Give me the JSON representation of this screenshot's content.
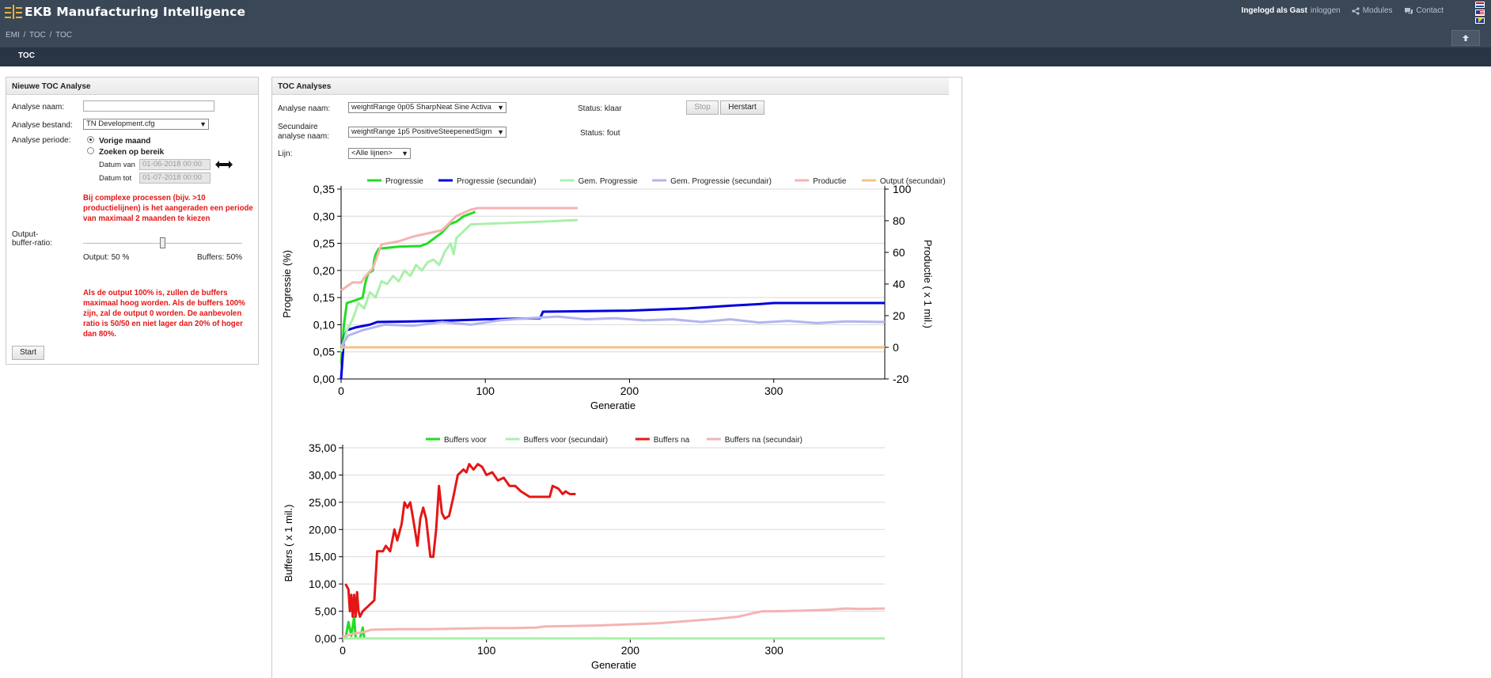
{
  "app": {
    "title": "EKB Manufacturing Intelligence",
    "breadcrumb": [
      "EMI",
      "TOC",
      "TOC"
    ],
    "breadcrumb_sep": "/",
    "user_label": "Ingelogd als Gast",
    "login_link": "inloggen",
    "modules_link": "Modules",
    "contact_link": "Contact",
    "active_tab": "TOC",
    "flags": [
      "dutch-flag",
      "us-flag",
      "bosnian-flag"
    ]
  },
  "left_panel": {
    "title": "Nieuwe TOC Analyse",
    "name_label": "Analyse naam:",
    "name_value": "",
    "file_label": "Analyse bestand:",
    "file_value": "TN Development.cfg",
    "period_label": "Analyse periode:",
    "radio_prev": "Vorige maand",
    "radio_range": "Zoeken op bereik",
    "date_from_label": "Datum van",
    "date_from_value": "01-06-2018 00:00",
    "date_to_label": "Datum tot",
    "date_to_value": "01-07-2018 00:00",
    "warning_1": "Bij complexe processen (bijv. >10 productielijnen) is het aangeraden een periode van maximaal 2 maanden te kiezen",
    "ratio_label": "Output-buffer-ratio:",
    "output_label": "Output: 50   %",
    "buffers_label": "Buffers: 50%",
    "ratio_value": 0.5,
    "warning_2": "Als de output 100% is, zullen de buffers maximaal hoog worden. Als de buffers 100% zijn, zal de output 0 worden. De aanbevolen ratio is 50/50 en niet lager dan 20% of hoger dan 80%.",
    "start_button": "Start"
  },
  "right_panel": {
    "title": "TOC Analyses",
    "name_label": "Analyse naam:",
    "name_value": "weightRange 0p05 SharpNeat Sine Activa",
    "status_1": "Status: klaar",
    "stop_button": "Stop",
    "restart_button": "Herstart",
    "secondary_label_1": "Secundaire",
    "secondary_label_2": "analyse naam:",
    "secondary_value": "weightRange 1p5 PositiveSteepenedSigm",
    "status_2": "Status: fout",
    "line_label": "Lijn:",
    "line_value": "<Alle lijnen>"
  },
  "chart_data": [
    {
      "type": "line",
      "title": "",
      "xlabel": "Generatie",
      "ylabel": "Progressie (%)",
      "y2label": "Productie  ( x 1 mil.)",
      "xlim": [
        0,
        377
      ],
      "ylim": [
        0,
        0.35
      ],
      "y2lim": [
        -20,
        100
      ],
      "x_ticks": [
        "0",
        "100",
        "200",
        "300"
      ],
      "y_ticks": [
        "0,00",
        "0,05",
        "0,10",
        "0,15",
        "0,20",
        "0,25",
        "0,30",
        "0,35"
      ],
      "y2_ticks": [
        "-20",
        "0",
        "20",
        "40",
        "60",
        "80",
        "100"
      ],
      "grid": true,
      "legend_position": "top",
      "series": [
        {
          "name": "Progressie",
          "color": "#22dd22",
          "axis": "left",
          "points": [
            [
              0,
              0.03
            ],
            [
              2,
              0.1
            ],
            [
              4,
              0.14
            ],
            [
              10,
              0.145
            ],
            [
              15,
              0.15
            ],
            [
              17,
              0.18
            ],
            [
              19,
              0.195
            ],
            [
              22,
              0.2
            ],
            [
              23,
              0.22
            ],
            [
              24,
              0.23
            ],
            [
              26,
              0.24
            ],
            [
              40,
              0.244
            ],
            [
              55,
              0.245
            ],
            [
              60,
              0.25
            ],
            [
              65,
              0.26
            ],
            [
              70,
              0.27
            ],
            [
              75,
              0.285
            ],
            [
              80,
              0.29
            ],
            [
              85,
              0.3
            ],
            [
              90,
              0.305
            ],
            [
              93,
              0.308
            ]
          ]
        },
        {
          "name": "Progressie (secundair)",
          "color": "#0000dd",
          "axis": "left",
          "points": [
            [
              0,
              0.0
            ],
            [
              2,
              0.075
            ],
            [
              4,
              0.09
            ],
            [
              10,
              0.095
            ],
            [
              20,
              0.1
            ],
            [
              25,
              0.105
            ],
            [
              50,
              0.106
            ],
            [
              80,
              0.108
            ],
            [
              100,
              0.11
            ],
            [
              138,
              0.112
            ],
            [
              140,
              0.124
            ],
            [
              200,
              0.126
            ],
            [
              240,
              0.13
            ],
            [
              270,
              0.135
            ],
            [
              290,
              0.138
            ],
            [
              300,
              0.14
            ],
            [
              377,
              0.14
            ]
          ]
        },
        {
          "name": "Gem. Progressie",
          "color": "#aaf0aa",
          "axis": "left",
          "points": [
            [
              0,
              0.05
            ],
            [
              4,
              0.09
            ],
            [
              8,
              0.11
            ],
            [
              12,
              0.14
            ],
            [
              16,
              0.13
            ],
            [
              20,
              0.16
            ],
            [
              24,
              0.15
            ],
            [
              28,
              0.18
            ],
            [
              32,
              0.175
            ],
            [
              36,
              0.19
            ],
            [
              40,
              0.18
            ],
            [
              44,
              0.2
            ],
            [
              48,
              0.19
            ],
            [
              52,
              0.21
            ],
            [
              56,
              0.2
            ],
            [
              60,
              0.215
            ],
            [
              64,
              0.22
            ],
            [
              68,
              0.21
            ],
            [
              72,
              0.235
            ],
            [
              76,
              0.25
            ],
            [
              78,
              0.23
            ],
            [
              80,
              0.26
            ],
            [
              82,
              0.265
            ],
            [
              84,
              0.27
            ],
            [
              86,
              0.275
            ],
            [
              88,
              0.28
            ],
            [
              90,
              0.285
            ],
            [
              100,
              0.286
            ],
            [
              120,
              0.288
            ],
            [
              140,
              0.29
            ],
            [
              164,
              0.293
            ]
          ]
        },
        {
          "name": "Gem. Progressie (secundair)",
          "color": "#b4b4f0",
          "axis": "left",
          "points": [
            [
              0,
              0.06
            ],
            [
              5,
              0.08
            ],
            [
              15,
              0.09
            ],
            [
              30,
              0.1
            ],
            [
              50,
              0.098
            ],
            [
              70,
              0.105
            ],
            [
              90,
              0.1
            ],
            [
              110,
              0.108
            ],
            [
              130,
              0.112
            ],
            [
              150,
              0.115
            ],
            [
              170,
              0.11
            ],
            [
              190,
              0.112
            ],
            [
              210,
              0.108
            ],
            [
              230,
              0.11
            ],
            [
              250,
              0.105
            ],
            [
              270,
              0.11
            ],
            [
              290,
              0.104
            ],
            [
              310,
              0.107
            ],
            [
              330,
              0.103
            ],
            [
              350,
              0.106
            ],
            [
              377,
              0.105
            ]
          ]
        },
        {
          "name": "Productie",
          "color": "#f5b3b3",
          "axis": "right",
          "points": [
            [
              0,
              36
            ],
            [
              8,
              41
            ],
            [
              14,
              41
            ],
            [
              16,
              44
            ],
            [
              22,
              50
            ],
            [
              28,
              65
            ],
            [
              40,
              67
            ],
            [
              50,
              70
            ],
            [
              60,
              72
            ],
            [
              70,
              74
            ],
            [
              80,
              83
            ],
            [
              90,
              87
            ],
            [
              95,
              88
            ],
            [
              164,
              88
            ]
          ]
        },
        {
          "name": "Output (secundair)",
          "color": "#f6c08a",
          "axis": "right",
          "points": [
            [
              0,
              0
            ],
            [
              377,
              0
            ]
          ]
        }
      ]
    },
    {
      "type": "line",
      "title": "",
      "xlabel": "Generatie",
      "ylabel": "Buffers  ( x 1 mil.)",
      "xlim": [
        0,
        377
      ],
      "ylim": [
        0,
        35
      ],
      "x_ticks": [
        "0",
        "100",
        "200",
        "300"
      ],
      "y_ticks": [
        "0,00",
        "5,00",
        "10,00",
        "15,00",
        "20,00",
        "25,00",
        "30,00",
        "35,00"
      ],
      "grid": true,
      "legend_position": "top",
      "series": [
        {
          "name": "Buffers voor",
          "color": "#22dd22",
          "points": [
            [
              0,
              0
            ],
            [
              2,
              0
            ],
            [
              4,
              3
            ],
            [
              6,
              0.5
            ],
            [
              8,
              4
            ],
            [
              9,
              0
            ],
            [
              12,
              0
            ],
            [
              14,
              2
            ],
            [
              15,
              0
            ],
            [
              377,
              0
            ]
          ]
        },
        {
          "name": "Buffers voor (secundair)",
          "color": "#aaf0aa",
          "points": [
            [
              0,
              0
            ],
            [
              377,
              0
            ]
          ]
        },
        {
          "name": "Buffers na",
          "color": "#e51616",
          "points": [
            [
              2,
              10
            ],
            [
              4,
              9
            ],
            [
              5,
              5
            ],
            [
              6,
              8
            ],
            [
              7,
              4
            ],
            [
              8,
              8
            ],
            [
              9,
              4
            ],
            [
              10,
              8.5
            ],
            [
              11,
              5
            ],
            [
              12,
              4
            ],
            [
              14,
              5
            ],
            [
              18,
              6
            ],
            [
              22,
              7
            ],
            [
              24,
              16
            ],
            [
              28,
              16
            ],
            [
              30,
              17
            ],
            [
              33,
              16
            ],
            [
              36,
              20
            ],
            [
              38,
              18
            ],
            [
              41,
              21
            ],
            [
              43,
              25
            ],
            [
              45,
              24
            ],
            [
              47,
              25
            ],
            [
              49,
              22
            ],
            [
              52,
              17
            ],
            [
              54,
              22
            ],
            [
              56,
              24
            ],
            [
              58,
              22
            ],
            [
              61,
              15
            ],
            [
              63,
              15
            ],
            [
              65,
              20
            ],
            [
              67,
              28
            ],
            [
              69,
              23
            ],
            [
              71,
              22
            ],
            [
              74,
              22.5
            ],
            [
              77,
              26
            ],
            [
              80,
              30
            ],
            [
              84,
              31
            ],
            [
              86,
              30.5
            ],
            [
              88,
              32
            ],
            [
              91,
              31
            ],
            [
              94,
              32
            ],
            [
              97,
              31.5
            ],
            [
              100,
              30
            ],
            [
              104,
              30.5
            ],
            [
              108,
              29
            ],
            [
              112,
              29.5
            ],
            [
              116,
              28
            ],
            [
              120,
              28
            ],
            [
              124,
              27
            ],
            [
              130,
              26
            ],
            [
              140,
              26
            ],
            [
              144,
              26
            ],
            [
              146,
              28
            ],
            [
              150,
              27.5
            ],
            [
              153,
              26.5
            ],
            [
              155,
              27
            ],
            [
              158,
              26.5
            ],
            [
              162,
              26.5
            ]
          ]
        },
        {
          "name": "Buffers na (secundair)",
          "color": "#f5b3b3",
          "points": [
            [
              0,
              0.3
            ],
            [
              6,
              0.8
            ],
            [
              15,
              1.2
            ],
            [
              20,
              1.6
            ],
            [
              40,
              1.7
            ],
            [
              60,
              1.7
            ],
            [
              80,
              1.8
            ],
            [
              100,
              1.9
            ],
            [
              120,
              1.9
            ],
            [
              135,
              2.0
            ],
            [
              140,
              2.2
            ],
            [
              160,
              2.3
            ],
            [
              180,
              2.4
            ],
            [
              200,
              2.6
            ],
            [
              220,
              2.8
            ],
            [
              240,
              3.2
            ],
            [
              260,
              3.6
            ],
            [
              275,
              4.0
            ],
            [
              285,
              4.6
            ],
            [
              292,
              5.0
            ],
            [
              300,
              5.0
            ],
            [
              320,
              5.1
            ],
            [
              340,
              5.3
            ],
            [
              350,
              5.5
            ],
            [
              360,
              5.4
            ],
            [
              377,
              5.5
            ]
          ]
        }
      ]
    }
  ]
}
